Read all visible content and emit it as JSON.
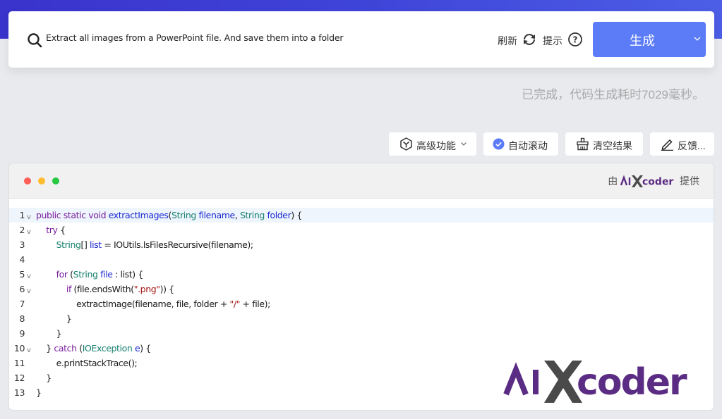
{
  "search": {
    "query": "Extract all images from a PowerPoint file. And save them into a folder",
    "refresh_label": "刷新",
    "hint_label": "提示",
    "generate_label": "生成"
  },
  "status_text": "已完成，代码生成耗时7029毫秒。",
  "toolbar": {
    "advanced_label": "高级功能",
    "autoscroll_label": "自动滚动",
    "clear_label": "清空结果",
    "feedback_label": "反馈..."
  },
  "panel": {
    "provided_prefix": "由",
    "provided_brand": "AIXcoder",
    "provided_suffix": "提供",
    "watermark": "AIXcoder"
  },
  "colors": {
    "accent": "#5b7bf7",
    "brand_purple": "#5b2c83",
    "brand_gray": "#4a4a4a",
    "dot_red": "#ff5f57",
    "dot_yellow": "#febc2e",
    "dot_green": "#28c840"
  },
  "code": {
    "language": "java",
    "lines": [
      {
        "n": "1",
        "fold": true,
        "text": "public static void extractImages(String filename, String folder) {"
      },
      {
        "n": "2",
        "fold": true,
        "text": "    try {"
      },
      {
        "n": "3",
        "fold": false,
        "text": "        String[] list = IOUtils.lsFilesRecursive(filename);"
      },
      {
        "n": "4",
        "fold": false,
        "text": ""
      },
      {
        "n": "5",
        "fold": true,
        "text": "        for (String file : list) {"
      },
      {
        "n": "6",
        "fold": true,
        "text": "            if (file.endsWith(\".png\")) {"
      },
      {
        "n": "7",
        "fold": false,
        "text": "                extractImage(filename, file, folder + \"/\" + file);"
      },
      {
        "n": "8",
        "fold": false,
        "text": "            }"
      },
      {
        "n": "9",
        "fold": false,
        "text": "        }"
      },
      {
        "n": "10",
        "fold": true,
        "text": "    } catch (IOException e) {"
      },
      {
        "n": "11",
        "fold": false,
        "text": "        e.printStackTrace();"
      },
      {
        "n": "12",
        "fold": false,
        "text": "    }"
      },
      {
        "n": "13",
        "fold": false,
        "text": "}"
      }
    ]
  }
}
